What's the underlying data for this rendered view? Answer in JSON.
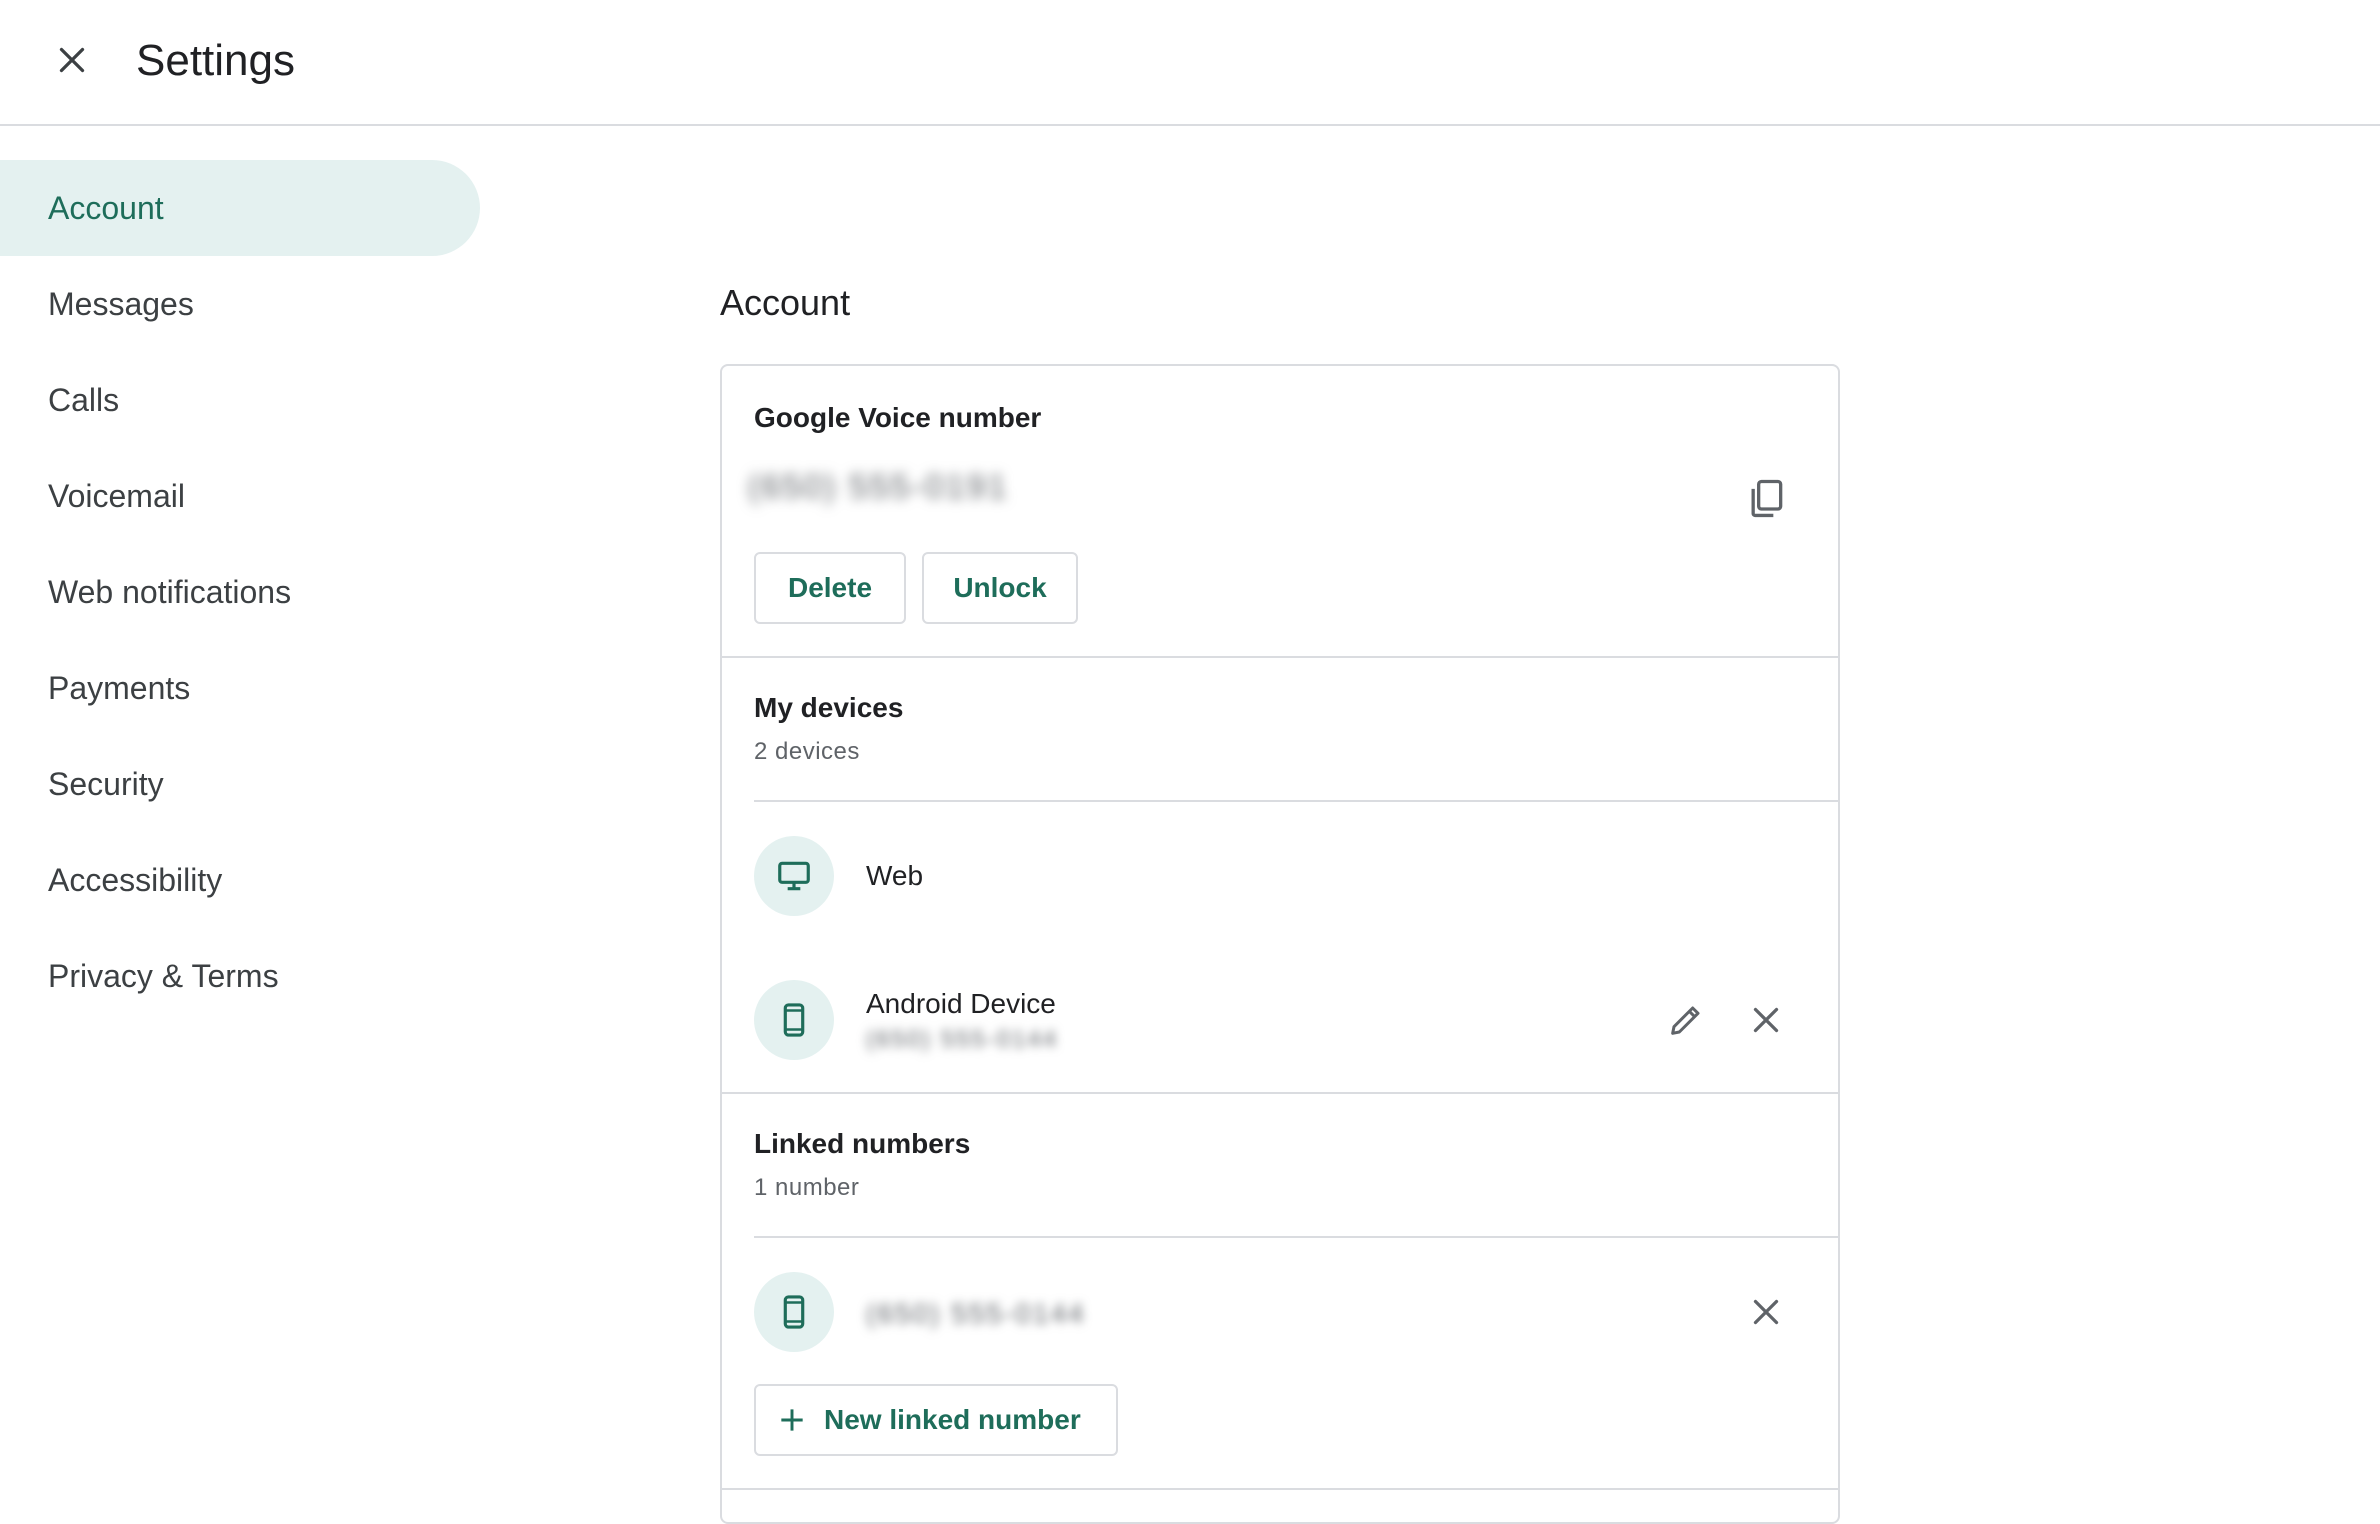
{
  "header": {
    "title": "Settings",
    "close_icon": "close-icon"
  },
  "sidebar": {
    "items": [
      {
        "label": "Account",
        "active": true
      },
      {
        "label": "Messages"
      },
      {
        "label": "Calls"
      },
      {
        "label": "Voicemail"
      },
      {
        "label": "Web notifications"
      },
      {
        "label": "Payments"
      },
      {
        "label": "Security"
      },
      {
        "label": "Accessibility"
      },
      {
        "label": "Privacy & Terms"
      }
    ]
  },
  "main": {
    "section_title": "Account",
    "voice_number": {
      "heading": "Google Voice number",
      "number_blurred": "(650) 555-0191",
      "delete_label": "Delete",
      "unlock_label": "Unlock"
    },
    "devices": {
      "heading": "My devices",
      "count": "2 devices",
      "items": [
        {
          "name": "Web",
          "icon": "monitor-icon"
        },
        {
          "name": "Android Device",
          "detail_blurred": "(650) 555-0144",
          "icon": "phone-icon"
        }
      ]
    },
    "linked_numbers": {
      "heading": "Linked numbers",
      "count": "1 number",
      "items": [
        {
          "number_blurred": "(650) 555-0144",
          "icon": "phone-icon"
        }
      ],
      "new_label": "New linked number"
    }
  },
  "colors": {
    "accent": "#1e6d5a",
    "accent_bg": "#e4f1f0",
    "divider": "#dadce0"
  }
}
